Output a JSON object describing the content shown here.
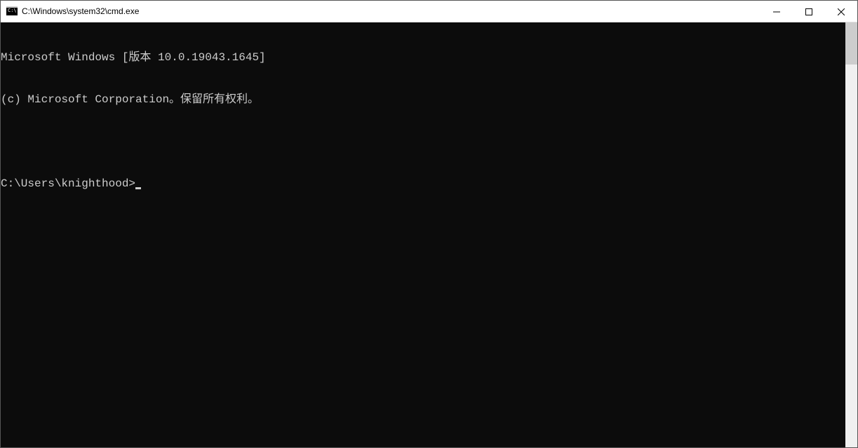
{
  "titlebar": {
    "title": "C:\\Windows\\system32\\cmd.exe"
  },
  "console": {
    "line1": "Microsoft Windows [版本 10.0.19043.1645]",
    "line2": "(c) Microsoft Corporation。保留所有权利。",
    "prompt": "C:\\Users\\knighthood>"
  }
}
